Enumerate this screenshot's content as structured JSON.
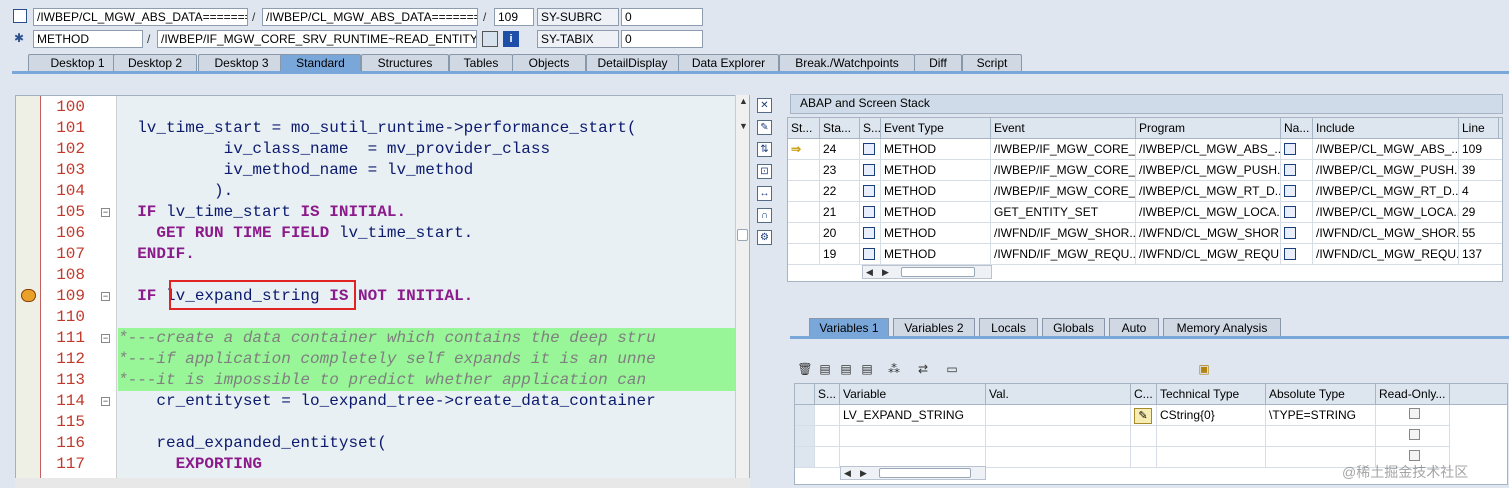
{
  "header": {
    "row1": {
      "field1": "/IWBEP/CL_MGW_ABS_DATA=======",
      "field2": "/IWBEP/CL_MGW_ABS_DATA=======",
      "line": "109",
      "sysname": "SY-SUBRC",
      "sysval": "0"
    },
    "row2": {
      "field1": "METHOD",
      "field2": "/IWBEP/IF_MGW_CORE_SRV_RUNTIME~READ_ENTITY...",
      "sysname": "SY-TABIX",
      "sysval": "0"
    },
    "separator": "/"
  },
  "tabs": [
    "Desktop 1",
    "Desktop 2",
    "Desktop 3",
    "Standard",
    "Structures",
    "Tables",
    "Objects",
    "DetailDisplay",
    "Data Explorer",
    "Break./Watchpoints",
    "Diff",
    "Script"
  ],
  "active_tab": "Standard",
  "code": {
    "line_numbers": [
      "100",
      "101",
      "102",
      "103",
      "104",
      "105",
      "106",
      "107",
      "108",
      "109",
      "110",
      "111",
      "112",
      "113",
      "114",
      "115",
      "116",
      "117"
    ],
    "l101a": "lv_time_start = mo_sutil_runtime->",
    "l101b": "performance_start(",
    "l102": "iv_class_name  = mv_provider_class",
    "l103": "iv_method_name = lv_method",
    "l104": ").",
    "l105_kw1": "IF",
    "l105_id": "lv_time_start",
    "l105_kw2": "IS INITIAL.",
    "l106_kw": "GET RUN TIME FIELD",
    "l106_id": "lv_time_start.",
    "l107": "ENDIF.",
    "l109_kw1": "IF",
    "l109_id": "lv_expand_string",
    "l109_kw2": "IS NOT INITIAL.",
    "l111": "*---create a data container which contains the deep stru",
    "l112": "*---if application completely self expands it is an unne",
    "l113": "*---it is impossible to predict whether application can",
    "l114a": "cr_entityset = lo_expand_tree->",
    "l114b": "create_data_container",
    "l116": "read_expanded_entityset(",
    "l117": "EXPORTING"
  },
  "stack": {
    "title": "ABAP and Screen Stack",
    "columns": [
      "St...",
      "Sta...",
      "S...",
      "Event Type",
      "Event",
      "Program",
      "Na...",
      "Include",
      "Line"
    ],
    "rows": [
      {
        "level": "24",
        "type": "METHOD",
        "event": "/IWBEP/IF_MGW_CORE_...",
        "program": "/IWBEP/CL_MGW_ABS_...",
        "include": "/IWBEP/CL_MGW_ABS_...",
        "line": "109"
      },
      {
        "level": "23",
        "type": "METHOD",
        "event": "/IWBEP/IF_MGW_CORE_...",
        "program": "/IWBEP/CL_MGW_PUSH...",
        "include": "/IWBEP/CL_MGW_PUSH...",
        "line": "39"
      },
      {
        "level": "22",
        "type": "METHOD",
        "event": "/IWBEP/IF_MGW_CORE_...",
        "program": "/IWBEP/CL_MGW_RT_D...",
        "include": "/IWBEP/CL_MGW_RT_D...",
        "line": "4"
      },
      {
        "level": "21",
        "type": "METHOD",
        "event": "GET_ENTITY_SET",
        "program": "/IWBEP/CL_MGW_LOCA...",
        "include": "/IWBEP/CL_MGW_LOCA...",
        "line": "29"
      },
      {
        "level": "20",
        "type": "METHOD",
        "event": "/IWFND/IF_MGW_SHOR...",
        "program": "/IWFND/CL_MGW_SHOR...",
        "include": "/IWFND/CL_MGW_SHOR...",
        "line": "55"
      },
      {
        "level": "19",
        "type": "METHOD",
        "event": "/IWFND/IF_MGW_REQU...",
        "program": "/IWFND/CL_MGW_REQU...",
        "include": "/IWFND/CL_MGW_REQU...",
        "line": "137"
      }
    ]
  },
  "var_tabs": [
    "Variables 1",
    "Variables 2",
    "Locals",
    "Globals",
    "Auto",
    "Memory Analysis"
  ],
  "active_var_tab": "Variables 1",
  "variables": {
    "columns": [
      "S...",
      "Variable",
      "Val.",
      "C...",
      "Technical Type",
      "Absolute Type",
      "Read-Only..."
    ],
    "rows": [
      {
        "variable": "LV_EXPAND_STRING",
        "value": "",
        "technical_type": "CString{0}",
        "absolute_type": "\\TYPE=STRING"
      }
    ]
  },
  "watermark": "@稀土掘金技术社区",
  "colors": {
    "accent": "#7aa7da",
    "keyword": "#8b1a8b",
    "comment_bg": "#98f598",
    "highlight": "#e02424"
  }
}
